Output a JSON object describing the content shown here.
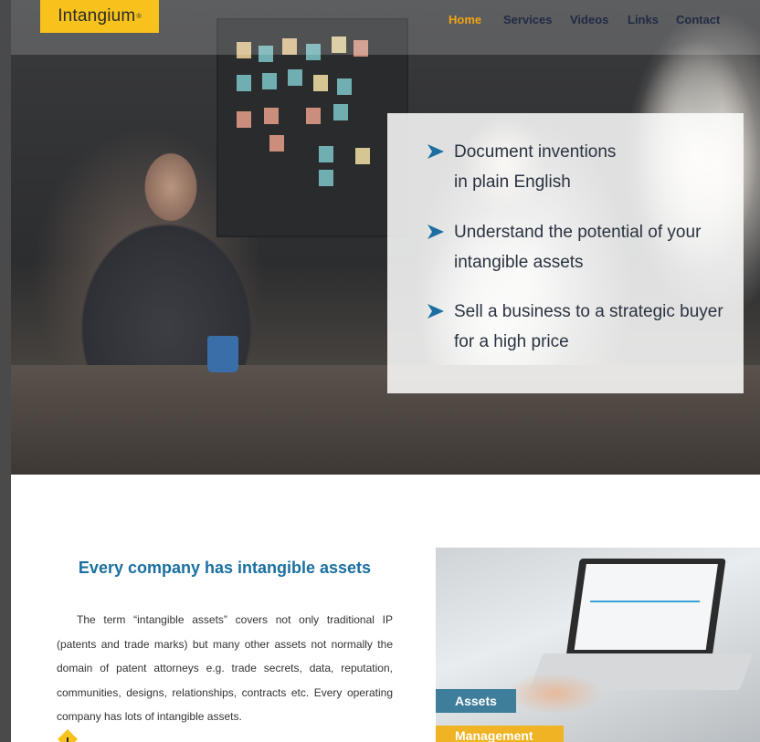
{
  "brand": {
    "logo_text": "Intangium",
    "logo_mark": "®",
    "accent_color": "#f6c21b"
  },
  "nav": {
    "items": [
      {
        "label": "Home",
        "active": true
      },
      {
        "label": "Services",
        "active": false
      },
      {
        "label": "Videos",
        "active": false
      },
      {
        "label": "Links",
        "active": false
      },
      {
        "label": "Contact",
        "active": false
      }
    ],
    "active_color": "#f2a413",
    "text_color": "#1f2a44"
  },
  "hero": {
    "bullets": [
      {
        "line1": "Document inventions",
        "line2": "in plain English"
      },
      {
        "line1": "Understand the potential of your",
        "line2": "intangible assets"
      },
      {
        "line1": "Sell a business to a strategic buyer",
        "line2": "for a high price"
      }
    ],
    "bullet_icon": "arrow-right-icon",
    "bullet_color": "#1a6fa0"
  },
  "intro": {
    "title": "Every company has intangible assets",
    "paragraph": "The term “intangible assets” covers not only traditional IP (patents and trade marks) but many other assets not normally the domain of patent attorneys e.g. trade secrets, data, reputation, communities, designs, relationships, contracts etc. Every operating company has lots of intangible assets.",
    "title_color": "#1a6fa0"
  },
  "feature_image": {
    "tag1": "Assets",
    "tag2": "Management",
    "tag1_color": "#3f7e9a",
    "tag2_color": "#f0b323"
  }
}
